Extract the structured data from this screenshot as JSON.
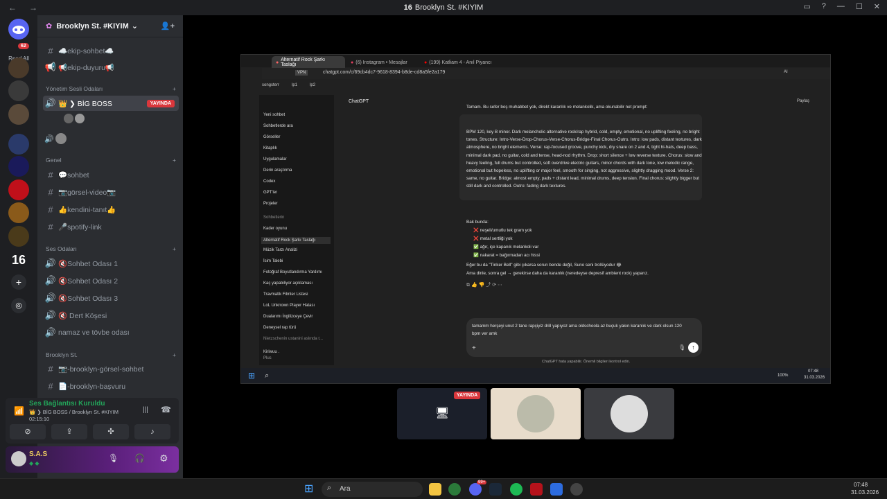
{
  "window": {
    "title": "Brooklyn St. #KIYIM",
    "logo": "16",
    "nav_back": "←",
    "nav_fwd": "→"
  },
  "serverbar": {
    "badge": "62",
    "read_all": "Read All",
    "server16": "16"
  },
  "server": {
    "name": "Brooklyn St. #KIYIM"
  },
  "channels": {
    "top": [
      {
        "name": "☁️ekip-sohbet☁️",
        "icon": "hash-speaker-icon"
      },
      {
        "name": "📢ekip-duyuru📢",
        "icon": "hash-speaker-icon"
      }
    ],
    "cat_admin": "Yönetim Sesli Odaları",
    "voice_boss": {
      "name": "👑 ❯ BİG BOSS",
      "live": "YAYINDA"
    },
    "cat_general": "Genel",
    "general": [
      {
        "name": "💬sohbet"
      },
      {
        "name": "📷görsel-video📷"
      },
      {
        "name": "👍kendini-tanıt👍"
      },
      {
        "name": "🎤spotify-link"
      }
    ],
    "cat_voice": "Ses Odaları",
    "voice": [
      {
        "name": "🔇Sohbet Odası 1"
      },
      {
        "name": "🔇Sohbet Odası 2"
      },
      {
        "name": "🔇Sohbet Odası 3"
      },
      {
        "name": "🔇 Dert Köşesi"
      },
      {
        "name": "namaz ve tövbe odası"
      }
    ],
    "cat_brooklyn": "Brooklyn St.",
    "brooklyn": [
      {
        "name": "📷-brooklyn-görsel-sohbet"
      },
      {
        "name": "📄-brooklyn-başvuru"
      }
    ]
  },
  "voice_panel": {
    "status": "Ses Bağlantısı Kuruldu",
    "channel": "👑 ❯ BİG BOSS / Brooklyn St. #KIYIM",
    "time": "02:15:10"
  },
  "user_panel": {
    "name": "S.A.S"
  },
  "shared": {
    "tabs": [
      "Alternatif Rock Şarkı Taslağı",
      "(6) Instagram • Mesajlar",
      "(199) Katliam 4 - Anıl Piyancı"
    ],
    "url": "chatgpt.com/c/69cb4dc7-9618-8394-b8de-cd8a5fe2a179",
    "vpn": "VPN",
    "bookmarks": [
      "songsterr",
      "lp1",
      "lp2"
    ],
    "gpt_title": "ChatGPT",
    "share": "Paylaş",
    "ai": "AI",
    "side_items": [
      "Yeni sohbet",
      "Sohbetlerde ara",
      "Görseller",
      "Kitaplık",
      "Uygulamalar",
      "Derin araştırma",
      "Codex",
      "GPT'ler",
      "Projeler"
    ],
    "side_section": "Sohbetlerin",
    "chats": [
      "Kader oyunu",
      "Alternatif Rock Şarkı Taslağı",
      "Müzik Tarzı Analizi",
      "İsim Talebi",
      "Fotoğraf Boyutlandırma Yardımı",
      "Kaç yapabiliyor açıklaması",
      "Travmatik Filmler Listesi",
      "LoL Unknown Player Hatası",
      "Dualarımı İngilizceye Çevir",
      "Deneysel rap türü",
      "Nietzschenin ustanini aslında t..."
    ],
    "user": "Kiriwuu .",
    "user_plan": "Plus",
    "msg_intro": "Tamam. Bu sefer boş muhabbet yok, direkt karanlık ve melankolik, ama okunabilir net prompt:",
    "prompt": "BPM 120, key B minor. Dark melancholic alternative rock/rap hybrid, cold, empty, emotional, no uplifting feeling, no bright tones. Structure: Intro-Verse-Drop-Chorus-Verse-Chorus-Bridge-Final Chorus-Outro. Intro: low pads, distant textures, dark atmosphere, no bright elements. Verse: rap-focused groove, punchy kick, dry snare on 2 and 4, tight hi-hats, deep bass, minimal dark pad, no guitar, cold and tense, head-nod rhythm. Drop: short silence + low reverse texture. Chorus: slow and heavy feeling, full drums but controlled, soft overdrive electric guitars, minor chords with dark tone, low melodic range, emotional but hopeless, no uplifting or major feel, smooth for singing, not aggressive, slightly dragging mood. Verse 2: same, no guitar. Bridge: almost empty, pads + distant lead, minimal drums, deep tension. Final chorus: slightly bigger but still dark and controlled. Outro: fading dark textures.",
    "list_title": "Bak bunda:",
    "list": [
      "❌ neşeli/umutlu tek gram yok",
      "❌ metal sertliği yok",
      "✅ ağır, içe kapanık melankoli var",
      "✅ nakarat = bağırmadan acı hissi"
    ],
    "note1": "Eğer bu da \"Tinker Bell\" gibi çıkarsa sorun bende değil, Suno seni trollüyodur 😂",
    "note2": "Ama dinle, sonra gel → gerekirse daha da karanlık (neredeyse depresif ambient rock) yaparız.",
    "input_text": "tamamm herşeyi unut 2 tane rapçiyiz drill yapıyoz ama oldschoola az buçuk yakın karanlık ve dark olsun 120 bpm ver amk",
    "disclaimer": "ChatGPT hata yapabilir. Önemli bilgileri kontrol edin.",
    "clock_time": "07:48",
    "clock_date": "31.03.2026",
    "battery": "100%"
  },
  "streams": {
    "live": "YAYINDA"
  },
  "taskbar": {
    "search": "Ara",
    "time": "07:48",
    "date": "31.03.2026",
    "badge": "99+"
  },
  "colors": {
    "discord_bg": "#2b2d31",
    "live_red": "#da373c",
    "green": "#23a55a"
  }
}
